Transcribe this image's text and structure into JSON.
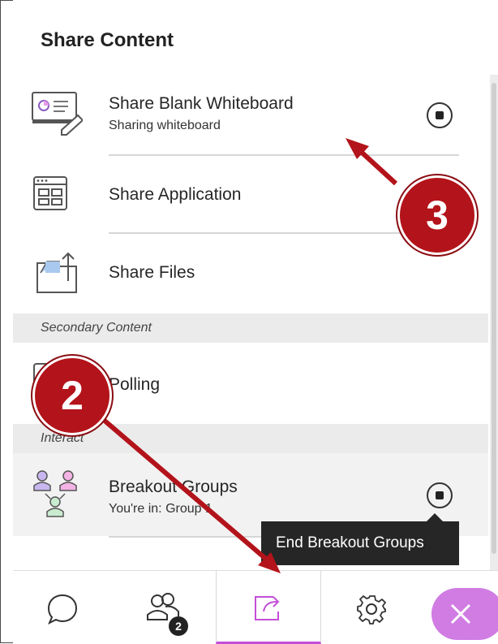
{
  "panel": {
    "title": "Share Content",
    "items": [
      {
        "label": "Share Blank Whiteboard",
        "sub": "Sharing whiteboard",
        "icon": "whiteboard-icon"
      },
      {
        "label": "Share Application",
        "icon": "application-icon"
      },
      {
        "label": "Share Files",
        "icon": "files-icon"
      }
    ],
    "secondary_section": "Secondary Content",
    "secondary_items": [
      {
        "label": "Polling",
        "icon": "polling-icon"
      }
    ],
    "interact_section": "Interact",
    "interact_items": [
      {
        "label": "Breakout Groups",
        "sub": "You're in: Group 1",
        "icon": "breakout-groups-icon"
      }
    ]
  },
  "tooltip": {
    "text": "End Breakout Groups"
  },
  "bottom_nav": {
    "tabs": [
      {
        "name": "chat",
        "icon": "chat-icon"
      },
      {
        "name": "attendees",
        "icon": "attendees-icon",
        "badge": "2"
      },
      {
        "name": "share-content",
        "icon": "share-icon",
        "active": true
      },
      {
        "name": "settings",
        "icon": "gear-icon"
      }
    ],
    "leave_icon": "close-icon"
  },
  "annotations": {
    "callout_2": "2",
    "callout_3": "3"
  },
  "colors": {
    "accent": "#c24fd6",
    "leave_button": "#d07ce3",
    "callout": "#b3131a",
    "tooltip_bg": "#262626"
  }
}
